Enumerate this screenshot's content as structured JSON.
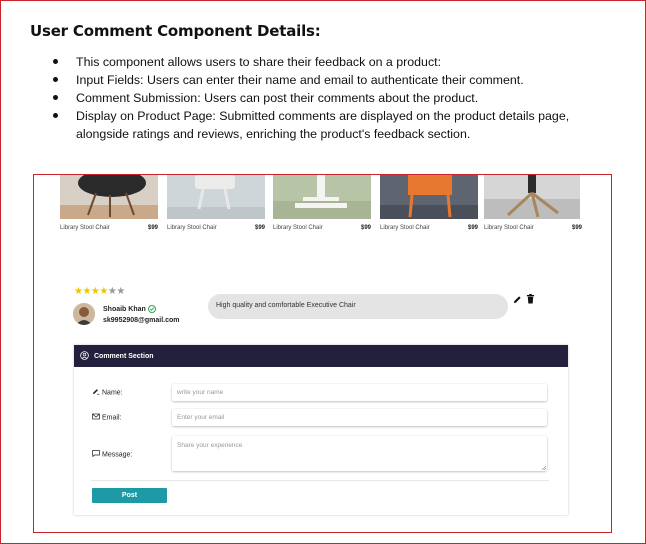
{
  "heading": "User Comment Component Details:",
  "bullets": [
    "This component allows users to share their feedback on a product:",
    "Input Fields: Users can enter their name and email to authenticate their comment.",
    "Comment Submission: Users can post their comments about the product.",
    "Display on Product Page: Submitted comments are displayed on the product details page, alongside ratings and reviews, enriching the product's feedback section."
  ],
  "products": [
    {
      "name": "Library Stool Chair",
      "price": "$99"
    },
    {
      "name": "Library Stool Chair",
      "price": "$99"
    },
    {
      "name": "Library Stool Chair",
      "price": "$99"
    },
    {
      "name": "Library Stool Chair",
      "price": "$99"
    },
    {
      "name": "Library Stool Chair",
      "price": "$99"
    }
  ],
  "review": {
    "stars_filled": "★★★★",
    "stars_empty": "★★",
    "rating": 4,
    "rating_max": 6,
    "user_name": "Shoaib Khan",
    "user_email": "sk9952908@gmail.com",
    "comment": "High quality and comfortable Executive Chair"
  },
  "form": {
    "title": "Comment Section",
    "name_label": "Name:",
    "name_placeholder": "write your name",
    "email_label": "Email:",
    "email_placeholder": "Enter your email",
    "message_label": "Message:",
    "message_placeholder": "Share your experience",
    "post_label": "Post"
  },
  "colors": {
    "frame_border": "#c8252b",
    "header_bg": "#23203d",
    "post_button": "#1e9aa6",
    "star_on": "#f2c400",
    "verified": "#2fa84f"
  },
  "icons": [
    "edit-icon",
    "trash-icon",
    "user-circle-icon",
    "pen-icon",
    "envelope-icon",
    "message-icon",
    "verified-icon"
  ]
}
